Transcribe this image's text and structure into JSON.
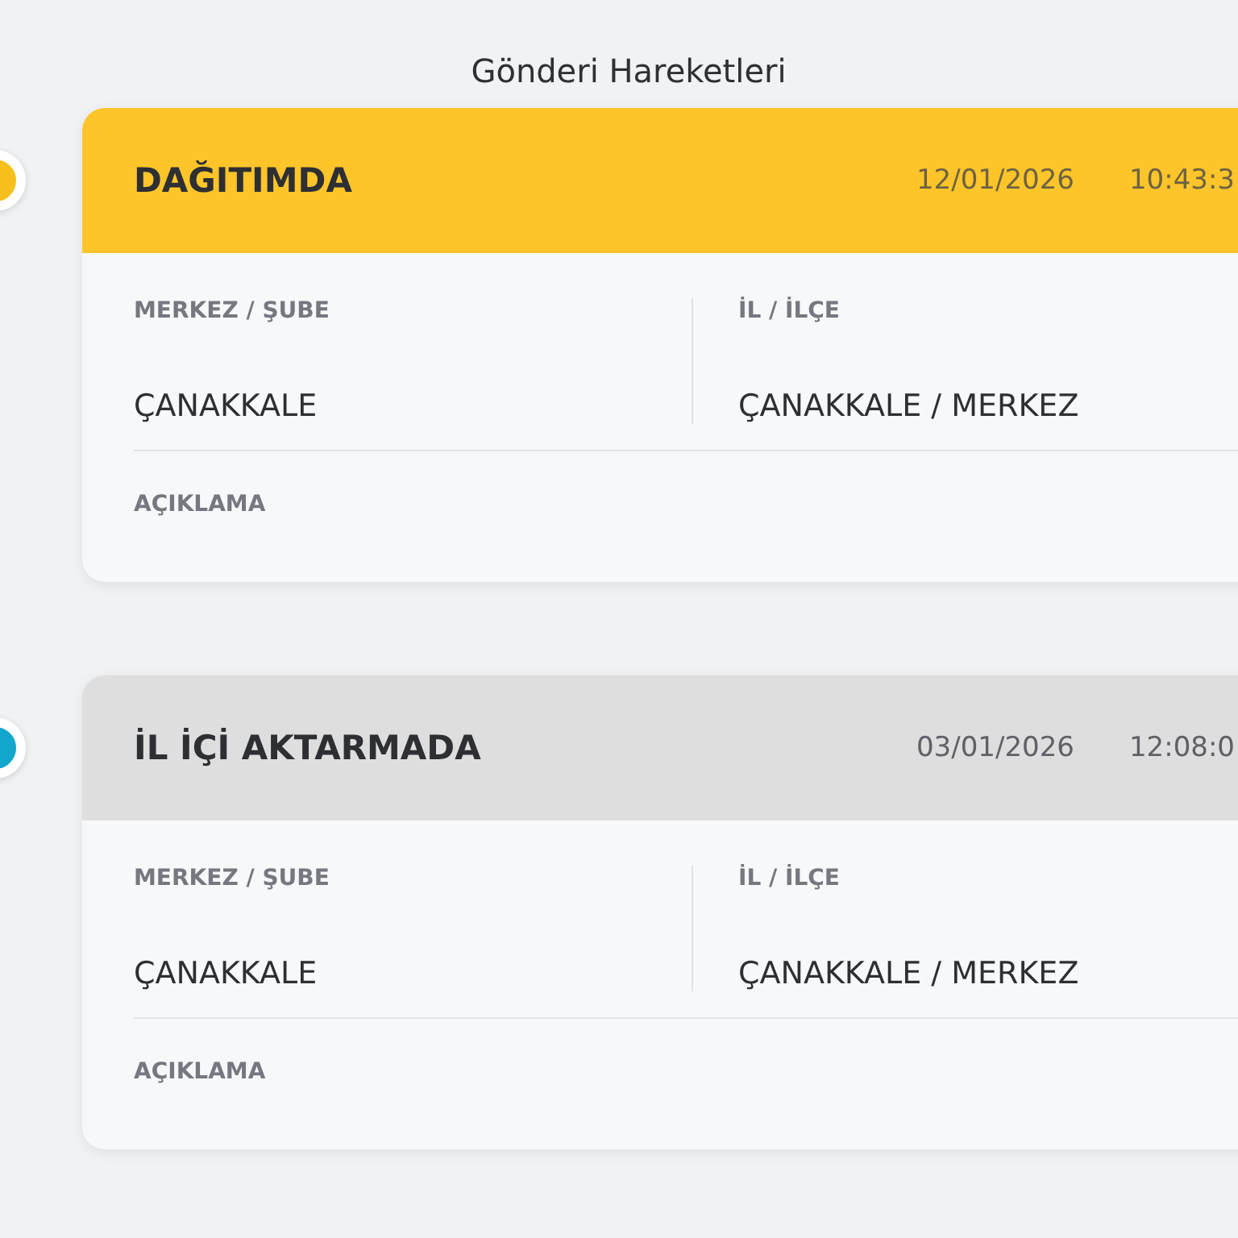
{
  "title": "Gönderi Hareketleri",
  "events": [
    {
      "kind": "current",
      "color": "#f7bf1c",
      "status": "DAĞITIMDA",
      "date": "12/01/2026",
      "time": "10:43:3",
      "fields": [
        {
          "label": "MERKEZ / ŞUBE",
          "value": "ÇANAKKALE"
        },
        {
          "label": "İL / İLÇE",
          "value": "ÇANAKKALE / MERKEZ"
        }
      ],
      "note_label": "AÇIKLAMA"
    },
    {
      "kind": "past",
      "color": "#12a6cc",
      "status": "İL İÇİ AKTARMADA",
      "date": "03/01/2026",
      "time": "12:08:0",
      "fields": [
        {
          "label": "MERKEZ / ŞUBE",
          "value": "ÇANAKKALE"
        },
        {
          "label": "İL / İLÇE",
          "value": "ÇANAKKALE / MERKEZ"
        }
      ],
      "note_label": "AÇIKLAMA"
    }
  ]
}
